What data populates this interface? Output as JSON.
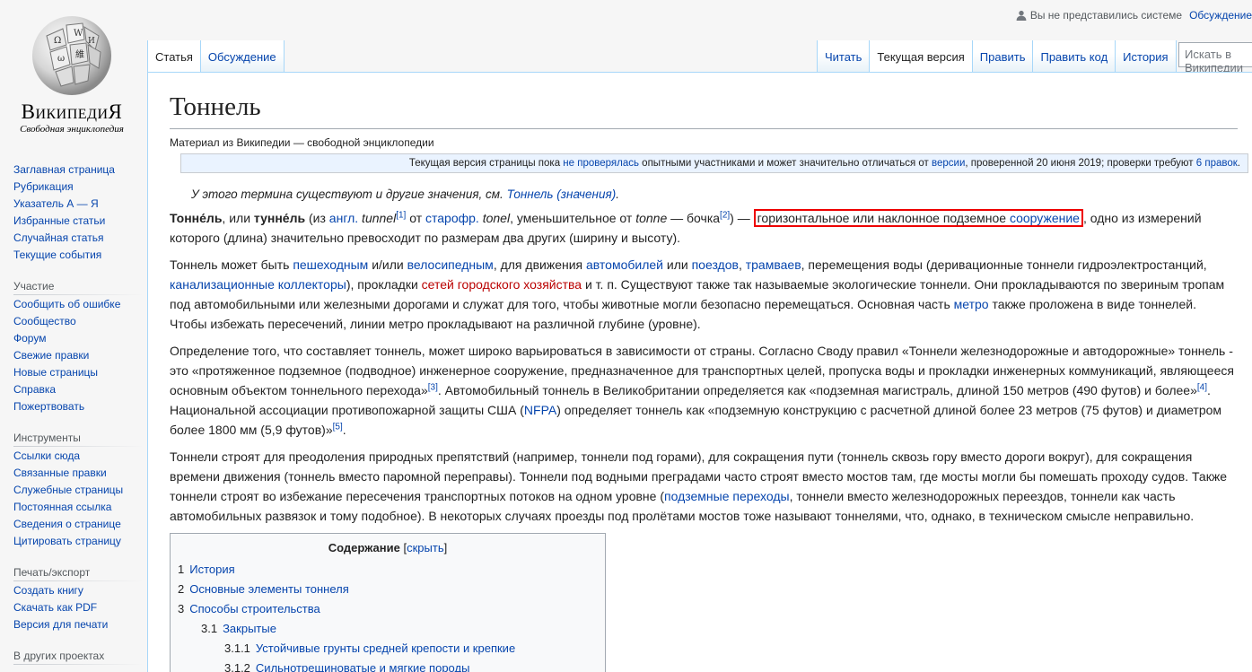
{
  "personal": {
    "not_logged": "Вы не представились системе",
    "talk": "Обсуждение"
  },
  "logo": {
    "wordmark": "ВикипедиЯ",
    "tagline": "Свободная энциклопедия"
  },
  "sidebar": {
    "nav": [
      "Заглавная страница",
      "Рубрикация",
      "Указатель А — Я",
      "Избранные статьи",
      "Случайная статья",
      "Текущие события"
    ],
    "participation_head": "Участие",
    "participation": [
      "Сообщить об ошибке",
      "Сообщество",
      "Форум",
      "Свежие правки",
      "Новые страницы",
      "Справка",
      "Пожертвовать"
    ],
    "tools_head": "Инструменты",
    "tools": [
      "Ссылки сюда",
      "Связанные правки",
      "Служебные страницы",
      "Постоянная ссылка",
      "Сведения о странице",
      "Цитировать страницу"
    ],
    "print_head": "Печать/экспорт",
    "print": [
      "Создать книгу",
      "Скачать как PDF",
      "Версия для печати"
    ],
    "other_head": "В других проектах"
  },
  "tabs": {
    "left": [
      "Статья",
      "Обсуждение"
    ],
    "right": [
      "Читать",
      "Текущая версия",
      "Править",
      "Править код",
      "История"
    ],
    "search_placeholder": "Искать в Википедии"
  },
  "article": {
    "title": "Тоннель",
    "site_sub": "Материал из Википедии — свободной энциклопедии",
    "review": {
      "t1": "Текущая версия страницы пока ",
      "l1": "не проверялась",
      "t2": " опытными участниками и может значительно отличаться от ",
      "l2": "версии",
      "t3": ", проверенной 20 июня 2019; проверки требуют ",
      "l3": "6 правок",
      "t4": "."
    },
    "hatnote": {
      "text": "У этого термина существуют и другие значения, см. ",
      "link": "Тоннель (значения)",
      "end": "."
    },
    "p1": {
      "b1": "Тонне́ль",
      "t1": ", или ",
      "b2": "тунне́ль",
      "t2": " (из ",
      "l1": "англ.",
      "i1": " tunnel",
      "s1": "[1]",
      "t3": " от ",
      "l2": "старофр.",
      "i2": " tonel",
      "t4": ", уменьшительное от ",
      "i3": "tonne",
      "t5": " — бочка",
      "s2": "[2]",
      "t6": ") — ",
      "h1": "горизонтальное или наклонное подземное ",
      "hl": "сооружение",
      "t7": ", одно из измерений которого (длина) значительно превосходит по размерам два других (ширину и высоту)."
    },
    "p2": {
      "t1": "Тоннель может быть ",
      "l1": "пешеходным",
      "t2": " и/или ",
      "l2": "велосипедным",
      "t3": ", для движения ",
      "l3": "автомобилей",
      "t4": " или ",
      "l4": "поездов",
      "t5": ", ",
      "l5": "трамваев",
      "t6": ", перемещения воды (деривационные тоннели гидроэлектростанций, ",
      "l6": "канализационные коллекторы",
      "t7": "), прокладки ",
      "r1": "сетей городского хозяйства",
      "t8": " и т. п. Существуют также так называемые экологические тоннели. Они прокладываются по звериным тропам под автомобильными или железными дорогами и служат для того, чтобы животные могли безопасно перемещаться. Основная часть ",
      "l7": "метро",
      "t9": " также проложена в виде тоннелей. Чтобы избежать пересечений, линии метро прокладывают на различной глубине (уровне)."
    },
    "p3": {
      "t1": "Определение того, что составляет тоннель, может широко варьироваться в зависимости от страны. Согласно Своду правил «Тоннели железнодорожные и автодорожные» тоннель - это «протяженное подземное (подводное) инженерное сооружение, предназначенное для транспортных целей, пропуска воды и прокладки инженерных коммуникаций, являющееся основным объектом тоннельного перехода»",
      "s1": "[3]",
      "t2": ". Автомобильный тоннель в Великобритании определяется как «подземная магистраль, длиной 150 метров (490 футов) и более»",
      "s2": "[4]",
      "t3": ". Национальной ассоциации противопожарной защиты США (",
      "l1": "NFPA",
      "t4": ") определяет тоннель как «подземную конструкцию с расчетной длиной более 23 метров (75 футов) и диаметром более 1800 мм (5,9 футов)»",
      "s3": "[5]",
      "t5": "."
    },
    "p4": {
      "t1": "Тоннели строят для преодоления природных препятствий (например, тоннели под горами), для сокращения пути (тоннель сквозь гору вместо дороги вокруг), для сокращения времени движения (тоннель вместо паромной переправы). Тоннели под водными преградами часто строят вместо мостов там, где мосты могли бы помешать проходу судов. Также тоннели строят во избежание пересечения транспортных потоков на одном уровне (",
      "l1": "подземные переходы",
      "t2": ", тоннели вместо железнодорожных переездов, тоннели как часть автомобильных развязок и тому подобное). В некоторых случаях проезды под пролётами мостов тоже называют тоннелями, что, однако, в техническом смысле неправильно."
    },
    "toc": {
      "title": "Содержание",
      "toggle_open": "[",
      "toggle": "скрыть",
      "toggle_close": "]",
      "items": [
        {
          "num": "1",
          "label": "История"
        },
        {
          "num": "2",
          "label": "Основные элементы тоннеля"
        },
        {
          "num": "3",
          "label": "Способы строительства"
        },
        {
          "num": "3.1",
          "label": "Закрытые"
        },
        {
          "num": "3.1.1",
          "label": "Устойчивые грунты средней крепости и крепкие"
        },
        {
          "num": "3.1.2",
          "label": "Сильнотрещиноватые и мягкие породы"
        }
      ]
    }
  }
}
